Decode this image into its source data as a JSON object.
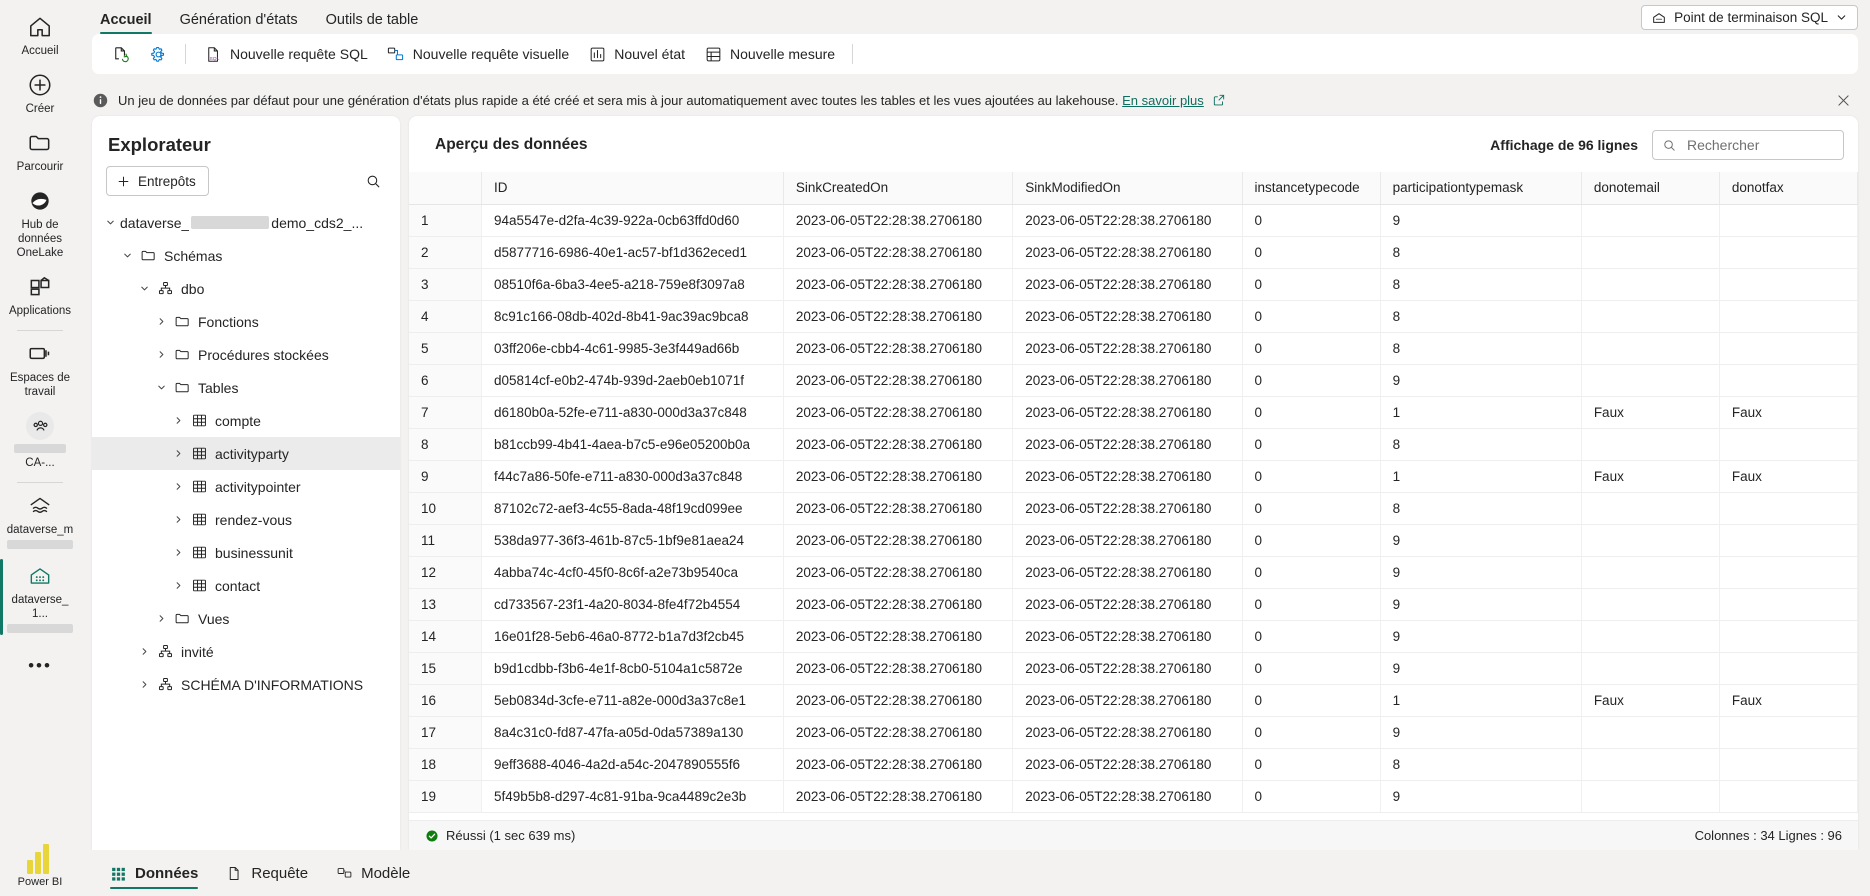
{
  "rail": {
    "items": [
      {
        "label": "Accueil",
        "icon": "home-icon"
      },
      {
        "label": "Créer",
        "icon": "plus-circle-icon"
      },
      {
        "label": "Parcourir",
        "icon": "folder-icon"
      },
      {
        "label": "Hub de données OneLake",
        "icon": "onelake-icon"
      },
      {
        "label": "Applications",
        "icon": "apps-icon"
      },
      {
        "label": "Espaces de travail",
        "icon": "workspaces-icon"
      },
      {
        "label": "CA-...",
        "icon": "people-group-icon"
      },
      {
        "label": "dataverse_m",
        "icon": "lakehouse-icon"
      },
      {
        "label": "dataverse_ 1...",
        "icon": "warehouse-icon"
      }
    ],
    "overflow_label": "•••",
    "product_logo": "power-bi-logo",
    "product_name": "Power BI"
  },
  "tabs": [
    {
      "label": "Accueil",
      "active": true
    },
    {
      "label": "Génération d'états",
      "active": false
    },
    {
      "label": "Outils de table",
      "active": false
    }
  ],
  "endpoint_button": {
    "label": "Point de terminaison SQL",
    "icon": "warehouse-icon"
  },
  "toolbar": {
    "refresh_icon": "refresh-page-icon",
    "settings_icon": "gear-icon",
    "items": [
      {
        "label": "Nouvelle requête SQL",
        "icon": "sql-file-icon"
      },
      {
        "label": "Nouvelle requête visuelle",
        "icon": "visual-query-icon"
      },
      {
        "label": "Nouvel état",
        "icon": "report-icon"
      },
      {
        "label": "Nouvelle mesure",
        "icon": "measure-icon"
      }
    ]
  },
  "infobar": {
    "icon": "info-icon",
    "text": "Un jeu de données par défaut pour une génération d'états plus rapide a été créé et sera mis à jour automatiquement avec toutes les tables et les vues ajoutées au lakehouse.",
    "link": "En savoir plus",
    "external_icon": "external-link-icon",
    "close_icon": "close-icon"
  },
  "explorer": {
    "title": "Explorateur",
    "add_button": "Entrepôts",
    "search_icon": "search-icon",
    "tree": [
      {
        "label": "dataverse_",
        "label_suffix": "demo_cds2_...",
        "indent": 0,
        "chevron": "down",
        "icon": "none",
        "redacted": true,
        "selected": false
      },
      {
        "label": "Schémas",
        "indent": 1,
        "chevron": "down",
        "icon": "folder-icon",
        "selected": false
      },
      {
        "label": "dbo",
        "indent": 2,
        "chevron": "down",
        "icon": "schema-icon",
        "selected": false
      },
      {
        "label": "Fonctions",
        "indent": 3,
        "chevron": "right",
        "icon": "folder-icon",
        "selected": false
      },
      {
        "label": "Procédures stockées",
        "indent": 3,
        "chevron": "right",
        "icon": "folder-icon",
        "selected": false
      },
      {
        "label": "Tables",
        "indent": 3,
        "chevron": "down",
        "icon": "folder-icon",
        "selected": false
      },
      {
        "label": "compte",
        "indent": 4,
        "chevron": "right",
        "icon": "table-icon",
        "selected": false
      },
      {
        "label": "activityparty",
        "indent": 4,
        "chevron": "right",
        "icon": "table-icon",
        "selected": true
      },
      {
        "label": "activitypointer",
        "indent": 4,
        "chevron": "right",
        "icon": "table-icon",
        "selected": false
      },
      {
        "label": "rendez-vous",
        "indent": 4,
        "chevron": "right",
        "icon": "table-icon",
        "selected": false
      },
      {
        "label": "businessunit",
        "indent": 4,
        "chevron": "right",
        "icon": "table-icon",
        "selected": false
      },
      {
        "label": "contact",
        "indent": 4,
        "chevron": "right",
        "icon": "table-icon",
        "selected": false
      },
      {
        "label": "Vues",
        "indent": 3,
        "chevron": "right",
        "icon": "folder-icon",
        "selected": false
      },
      {
        "label": "invité",
        "indent": 2,
        "chevron": "right",
        "icon": "schema-icon",
        "selected": false
      },
      {
        "label": "SCHÉMA D'INFORMATIONS",
        "indent": 2,
        "chevron": "right",
        "icon": "schema-icon",
        "selected": false
      }
    ]
  },
  "grid": {
    "title": "Aperçu des données",
    "rows_label": "Affichage de 96 lignes",
    "search_placeholder": "Rechercher",
    "search_value": "",
    "search_icon": "search-icon",
    "columns": [
      "",
      "ID",
      "SinkCreatedOn",
      "SinkModifiedOn",
      "instancetypecode",
      "participationtypemask",
      "donotemail",
      "donotfax"
    ],
    "rows": [
      [
        "1",
        "94a5547e-d2fa-4c39-922a-0cb63ffd0d60",
        "2023-06-05T22:28:38.2706180",
        "2023-06-05T22:28:38.2706180",
        "0",
        "9",
        "",
        ""
      ],
      [
        "2",
        "d5877716-6986-40e1-ac57-bf1d362eced1",
        "2023-06-05T22:28:38.2706180",
        "2023-06-05T22:28:38.2706180",
        "0",
        "8",
        "",
        ""
      ],
      [
        "3",
        "08510f6a-6ba3-4ee5-a218-759e8f3097a8",
        "2023-06-05T22:28:38.2706180",
        "2023-06-05T22:28:38.2706180",
        "0",
        "8",
        "",
        ""
      ],
      [
        "4",
        "8c91c166-08db-402d-8b41-9ac39ac9bca8",
        "2023-06-05T22:28:38.2706180",
        "2023-06-05T22:28:38.2706180",
        "0",
        "8",
        "",
        ""
      ],
      [
        "5",
        "03ff206e-cbb4-4c61-9985-3e3f449ad66b",
        "2023-06-05T22:28:38.2706180",
        "2023-06-05T22:28:38.2706180",
        "0",
        "8",
        "",
        ""
      ],
      [
        "6",
        "d05814cf-e0b2-474b-939d-2aeb0eb1071f",
        "2023-06-05T22:28:38.2706180",
        "2023-06-05T22:28:38.2706180",
        "0",
        "9",
        "",
        ""
      ],
      [
        "7",
        "d6180b0a-52fe-e711-a830-000d3a37c848",
        "2023-06-05T22:28:38.2706180",
        "2023-06-05T22:28:38.2706180",
        "0",
        "1",
        "Faux",
        "Faux"
      ],
      [
        "8",
        "b81ccb99-4b41-4aea-b7c5-e96e05200b0a",
        "2023-06-05T22:28:38.2706180",
        "2023-06-05T22:28:38.2706180",
        "0",
        "8",
        "",
        ""
      ],
      [
        "9",
        "f44c7a86-50fe-e711-a830-000d3a37c848",
        "2023-06-05T22:28:38.2706180",
        "2023-06-05T22:28:38.2706180",
        "0",
        "1",
        "Faux",
        "Faux"
      ],
      [
        "10",
        "87102c72-aef3-4c55-8ada-48f19cd099ee",
        "2023-06-05T22:28:38.2706180",
        "2023-06-05T22:28:38.2706180",
        "0",
        "8",
        "",
        ""
      ],
      [
        "11",
        "538da977-36f3-461b-87c5-1bf9e81aea24",
        "2023-06-05T22:28:38.2706180",
        "2023-06-05T22:28:38.2706180",
        "0",
        "9",
        "",
        ""
      ],
      [
        "12",
        "4abba74c-4cf0-45f0-8c6f-a2e73b9540ca",
        "2023-06-05T22:28:38.2706180",
        "2023-06-05T22:28:38.2706180",
        "0",
        "9",
        "",
        ""
      ],
      [
        "13",
        "cd733567-23f1-4a20-8034-8fe4f72b4554",
        "2023-06-05T22:28:38.2706180",
        "2023-06-05T22:28:38.2706180",
        "0",
        "9",
        "",
        ""
      ],
      [
        "14",
        "16e01f28-5eb6-46a0-8772-b1a7d3f2cb45",
        "2023-06-05T22:28:38.2706180",
        "2023-06-05T22:28:38.2706180",
        "0",
        "9",
        "",
        ""
      ],
      [
        "15",
        "b9d1cdbb-f3b6-4e1f-8cb0-5104a1c5872e",
        "2023-06-05T22:28:38.2706180",
        "2023-06-05T22:28:38.2706180",
        "0",
        "9",
        "",
        ""
      ],
      [
        "16",
        "5eb0834d-3cfe-e711-a82e-000d3a37c8e1",
        "2023-06-05T22:28:38.2706180",
        "2023-06-05T22:28:38.2706180",
        "0",
        "1",
        "Faux",
        "Faux"
      ],
      [
        "17",
        "8a4c31c0-fd87-47fa-a05d-0da57389a130",
        "2023-06-05T22:28:38.2706180",
        "2023-06-05T22:28:38.2706180",
        "0",
        "9",
        "",
        ""
      ],
      [
        "18",
        "9eff3688-4046-4a2d-a54c-2047890555f6",
        "2023-06-05T22:28:38.2706180",
        "2023-06-05T22:28:38.2706180",
        "0",
        "8",
        "",
        ""
      ],
      [
        "19",
        "5f49b5b8-d297-4c81-91ba-9ca4489c2e3b",
        "2023-06-05T22:28:38.2706180",
        "2023-06-05T22:28:38.2706180",
        "0",
        "9",
        "",
        ""
      ]
    ],
    "status": {
      "icon": "success-check-icon",
      "text": "Réussi (1 sec 639 ms)",
      "counts": "Colonnes : 34 Lignes : 96"
    }
  },
  "bottom_modes": [
    {
      "label": "Données",
      "icon": "data-grid-icon",
      "active": true
    },
    {
      "label": "Requête",
      "icon": "query-page-icon",
      "active": false
    },
    {
      "label": "Modèle",
      "icon": "model-icon",
      "active": false
    }
  ],
  "colors": {
    "accent": "#117865",
    "link": "#0f6e5e",
    "selected_row": "#ebebeb",
    "success": "#107c10",
    "logo_yellow": "#e8d53a"
  }
}
